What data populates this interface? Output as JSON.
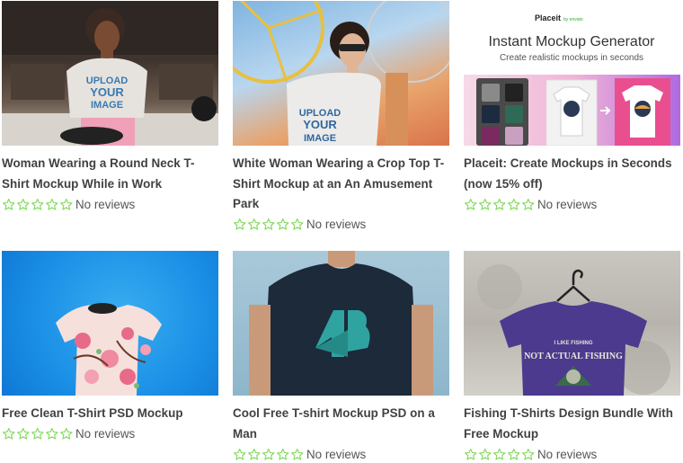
{
  "products": [
    {
      "title": "Woman Wearing a Round Neck T-Shirt Mockup While in Work",
      "reviews": "No reviews",
      "shirt_text": [
        "UPLOAD",
        "YOUR",
        "IMAGE"
      ]
    },
    {
      "title": "White Woman Wearing a Crop Top T-Shirt Mockup at an An Amusement Park",
      "reviews": "No reviews",
      "shirt_text": [
        "UPLOAD",
        "YOUR",
        "IMAGE"
      ]
    },
    {
      "title": "Placeit: Create Mockups in Seconds (now 15% off)",
      "reviews": "No reviews",
      "banner": {
        "brand": "Placeit",
        "brand_sub": "by envato",
        "heading": "Instant Mockup Generator",
        "subheading": "Create realistic mockups in seconds"
      }
    },
    {
      "title": "Free Clean T-Shirt PSD Mockup",
      "reviews": "No reviews"
    },
    {
      "title": "Cool Free T-shirt Mockup PSD on a Man",
      "reviews": "No reviews"
    },
    {
      "title": "Fishing T-Shirts Design Bundle With Free Mockup",
      "reviews": "No reviews",
      "shirt_text": [
        "I LIKE FISHING",
        "NOT ACTUAL FISHING"
      ]
    }
  ],
  "colors": {
    "star": "#7ed957",
    "title": "#414141"
  }
}
